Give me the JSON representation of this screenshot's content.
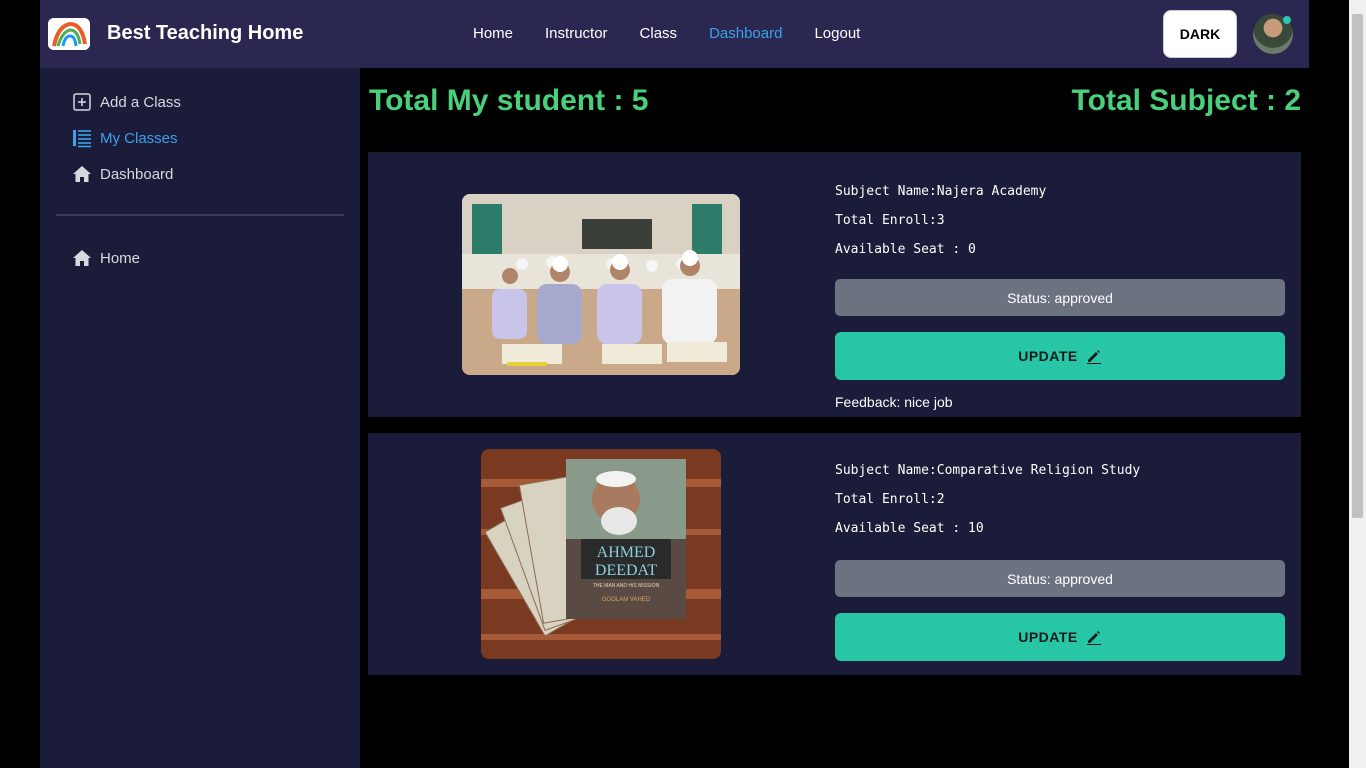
{
  "navbar": {
    "brand": "Best Teaching Home",
    "links": [
      "Home",
      "Instructor",
      "Class",
      "Dashboard",
      "Logout"
    ],
    "active_link": "Dashboard",
    "theme_button": "DARK"
  },
  "sidebar": {
    "items": [
      {
        "label": "Add a Class",
        "icon": "add-square-icon"
      },
      {
        "label": "My Classes",
        "icon": "list-icon",
        "active": true
      },
      {
        "label": "Dashboard",
        "icon": "home-icon"
      }
    ],
    "bottom_items": [
      {
        "label": "Home",
        "icon": "home-icon"
      }
    ]
  },
  "stats": {
    "students": "Total My student : 5",
    "subjects": "Total Subject : 2"
  },
  "classes": [
    {
      "subject": "Subject Name:Najera Academy",
      "enroll": "Total Enroll:3",
      "seats": "Available Seat : 0",
      "status": "Status: approved",
      "update": "UPDATE",
      "feedback": "Feedback: nice job"
    },
    {
      "subject": "Subject Name:Comparative Religion Study",
      "enroll": "Total Enroll:2",
      "seats": "Available Seat : 10",
      "status": "Status: approved",
      "update": "UPDATE",
      "book_title": "AHMED DEEDAT",
      "book_subtitle": "THE MAN AND HIS MISSION",
      "book_author": "GOOLAM VAHED"
    }
  ],
  "colors": {
    "navbar": "#2a2750",
    "sidebar": "#1b1b3a",
    "accent": "#3ea0ea",
    "stat": "#4ad07a",
    "update": "#26c6a6",
    "status": "#6b7280"
  }
}
